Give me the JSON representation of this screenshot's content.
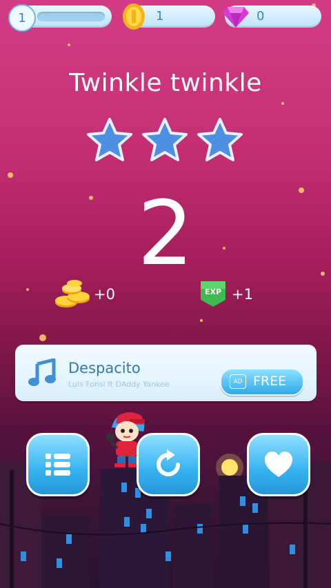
{
  "topbar": {
    "level": "1",
    "xp_progress": 0.0,
    "coins": "1",
    "gems": "0"
  },
  "result": {
    "song_title": "Twinkle twinkle",
    "stars_earned": 3,
    "stars_total": 3,
    "score": "2",
    "coin_reward": "+0",
    "exp_reward": "+1",
    "exp_badge": "EXP"
  },
  "next_song": {
    "title": "Despacito",
    "artist": "Luis Fonsi ft DAddy Yankee",
    "ad_label": "AD",
    "button_label": "FREE"
  },
  "icons": {
    "menu": "list-icon",
    "replay": "replay-icon",
    "like": "heart-icon",
    "song": "music-note-icon"
  },
  "colors": {
    "accent": "#36b2ef",
    "star": "#4d8fe0",
    "exp_badge": "#3dbb4e"
  }
}
